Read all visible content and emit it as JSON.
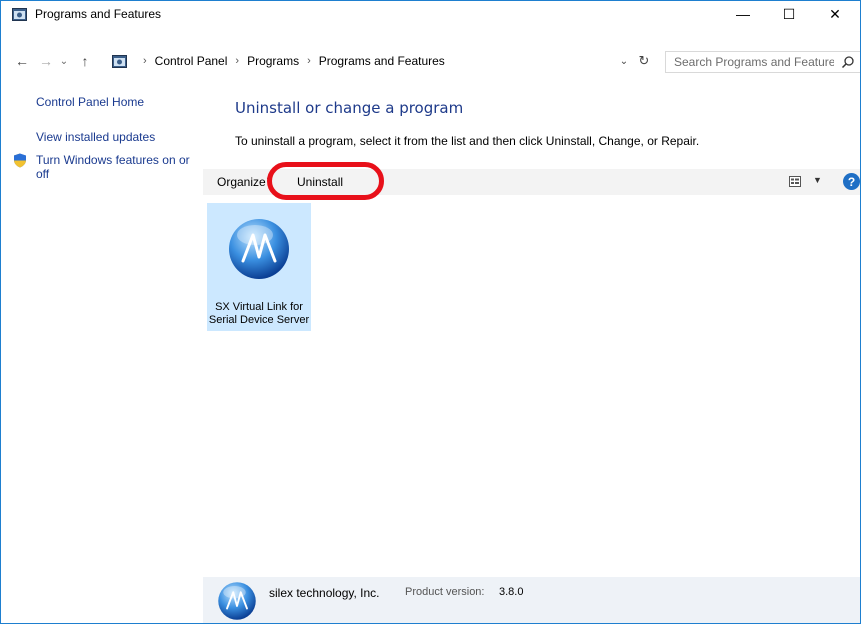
{
  "window": {
    "title": "Programs and Features",
    "minimize_glyph": "—",
    "maximize_glyph": "☐",
    "close_glyph": "✕"
  },
  "nav": {
    "back_glyph": "←",
    "forward_glyph": "→",
    "recent_glyph": "⌄",
    "up_glyph": "↑",
    "breadcrumbs": [
      "Control Panel",
      "Programs",
      "Programs and Features"
    ],
    "separator": "›",
    "dropdown_glyph": "⌄",
    "refresh_glyph": "↻",
    "search_placeholder": "Search Programs and Features"
  },
  "left_pane": {
    "home": "Control Panel Home",
    "updates": "View installed updates",
    "features": "Turn Windows features on or off"
  },
  "main": {
    "heading": "Uninstall or change a program",
    "subheading": "To uninstall a program, select it from the list and then click Uninstall, Change, or Repair."
  },
  "command_bar": {
    "organize": "Organize",
    "organize_arrow": "▼",
    "uninstall": "Uninstall",
    "view_arrow": "▼",
    "help_glyph": "?"
  },
  "programs": [
    {
      "name": "SX Virtual Link for Serial Device Server"
    }
  ],
  "details": {
    "publisher": "silex technology, Inc.",
    "version_label": "Product version:",
    "version_value": "3.8.0"
  },
  "colors": {
    "accent": "#1e7fcf",
    "link": "#1a3a8f",
    "selection": "#cce8ff",
    "highlight_ring": "#e8101a"
  },
  "icons": [
    "control-panel-icon",
    "shield-icon",
    "search-icon",
    "view-icon",
    "help-icon",
    "program-logo-icon"
  ]
}
